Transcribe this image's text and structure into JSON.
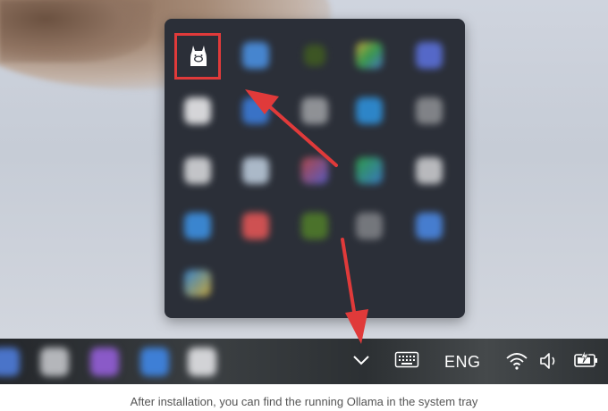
{
  "taskbar": {
    "language": "ENG",
    "apps": [
      "app-1",
      "app-2",
      "app-3",
      "app-4",
      "app-5"
    ]
  },
  "tray": {
    "highlighted_icon": "ollama-llama-icon",
    "overflow_icon": "chevron-up-icon"
  },
  "system_icons": [
    "keyboard-icon",
    "wifi-icon",
    "volume-icon",
    "battery-charging-icon"
  ],
  "caption": "After installation, you can find the running Ollama in the system tray",
  "colors": {
    "highlight": "#e03a3a",
    "flyout_bg": "#2b2f38",
    "taskbar_bg": "#33373a"
  }
}
